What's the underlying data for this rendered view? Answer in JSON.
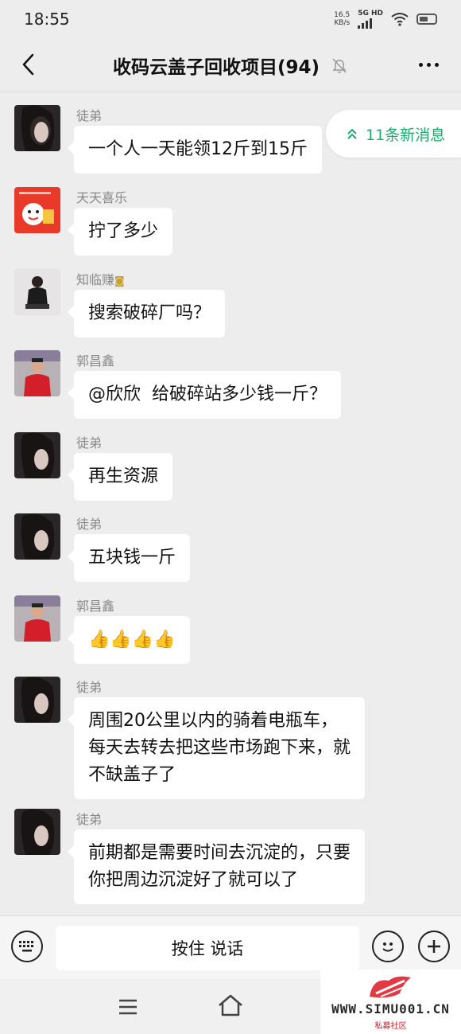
{
  "status_bar": {
    "time": "18:55",
    "net_speed_value": "16.5",
    "net_speed_unit": "KB/s",
    "network": "5G HD"
  },
  "header": {
    "title": "收码云盖子回收项目(94)"
  },
  "new_messages": {
    "label": "11条新消息"
  },
  "messages": [
    {
      "sender": "徒弟",
      "text": "一个人一天能领12斤到15斤"
    },
    {
      "sender": "天天喜乐",
      "text": "拧了多少"
    },
    {
      "sender": "知临赚",
      "text": "搜索破碎厂吗？"
    },
    {
      "sender": "郭昌鑫",
      "text": "@欣欣  给破碎站多少钱一斤？"
    },
    {
      "sender": "徒弟",
      "text": "再生资源"
    },
    {
      "sender": "徒弟",
      "text": "五块钱一斤"
    },
    {
      "sender": "郭昌鑫",
      "text": "👍👍👍👍"
    },
    {
      "sender": "徒弟",
      "text": "周围20公里以内的骑着电瓶车，\n每天去转去把这些市场跑下来，就\n不缺盖子了"
    },
    {
      "sender": "徒弟",
      "text": "前期都是需要时间去沉淀的，只要\n你把周边沉淀好了就可以了"
    }
  ],
  "input_bar": {
    "voice_label": "按住 说话"
  },
  "watermark": {
    "text": "WWW.SIMU001.CN",
    "sub": "私募社区"
  },
  "colors": {
    "accent_green": "#1aad6b",
    "background": "#ededed"
  }
}
